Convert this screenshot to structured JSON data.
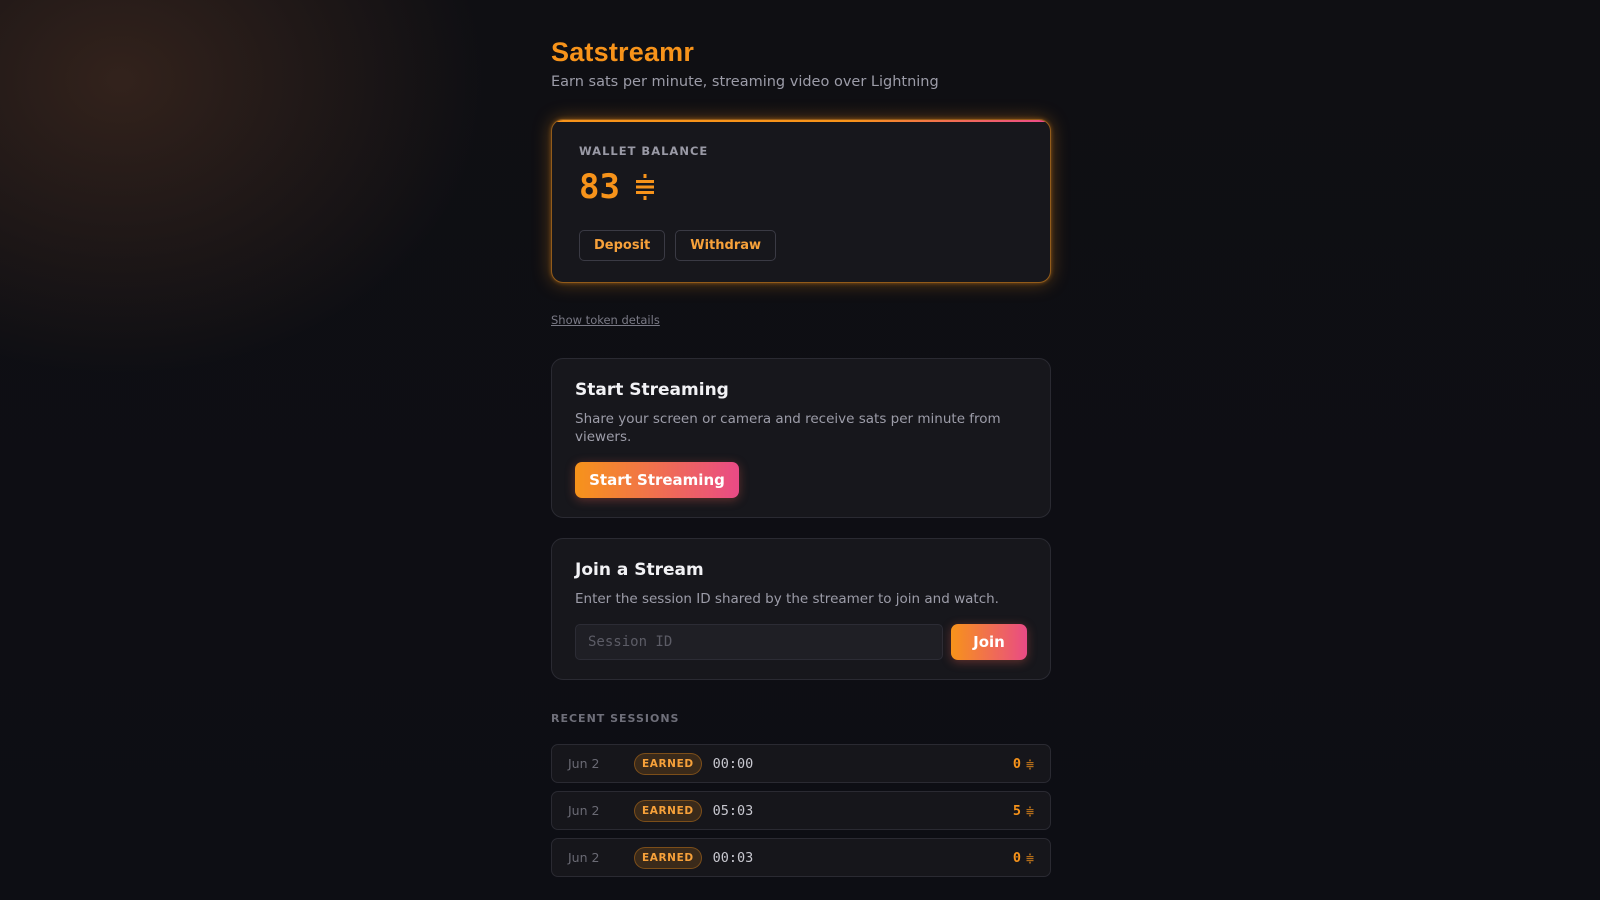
{
  "app": {
    "title": "Satstreamr",
    "subtitle": "Earn sats per minute, streaming video over Lightning"
  },
  "wallet": {
    "label": "WALLET BALANCE",
    "balance": "83",
    "unit_icon": "sats-icon",
    "deposit_label": "Deposit",
    "withdraw_label": "Withdraw"
  },
  "token_link": "Show token details",
  "start_panel": {
    "title": "Start Streaming",
    "description": "Share your screen or camera and receive sats per minute from viewers.",
    "button_label": "Start Streaming"
  },
  "join_panel": {
    "title": "Join a Stream",
    "description": "Enter the session ID shared by the streamer to join and watch.",
    "input_value": "",
    "input_placeholder": "Session ID",
    "button_label": "Join"
  },
  "recent": {
    "heading": "RECENT SESSIONS",
    "sessions": [
      {
        "date": "Jun 2",
        "badge": "EARNED",
        "duration": "00:00",
        "amount": "0"
      },
      {
        "date": "Jun 2",
        "badge": "EARNED",
        "duration": "05:03",
        "amount": "5"
      },
      {
        "date": "Jun 2",
        "badge": "EARNED",
        "duration": "00:03",
        "amount": "0"
      }
    ]
  },
  "colors": {
    "accent": "#f7931a",
    "accent_pink": "#e94a86",
    "background": "#0f0f13",
    "card": "#17171c"
  }
}
